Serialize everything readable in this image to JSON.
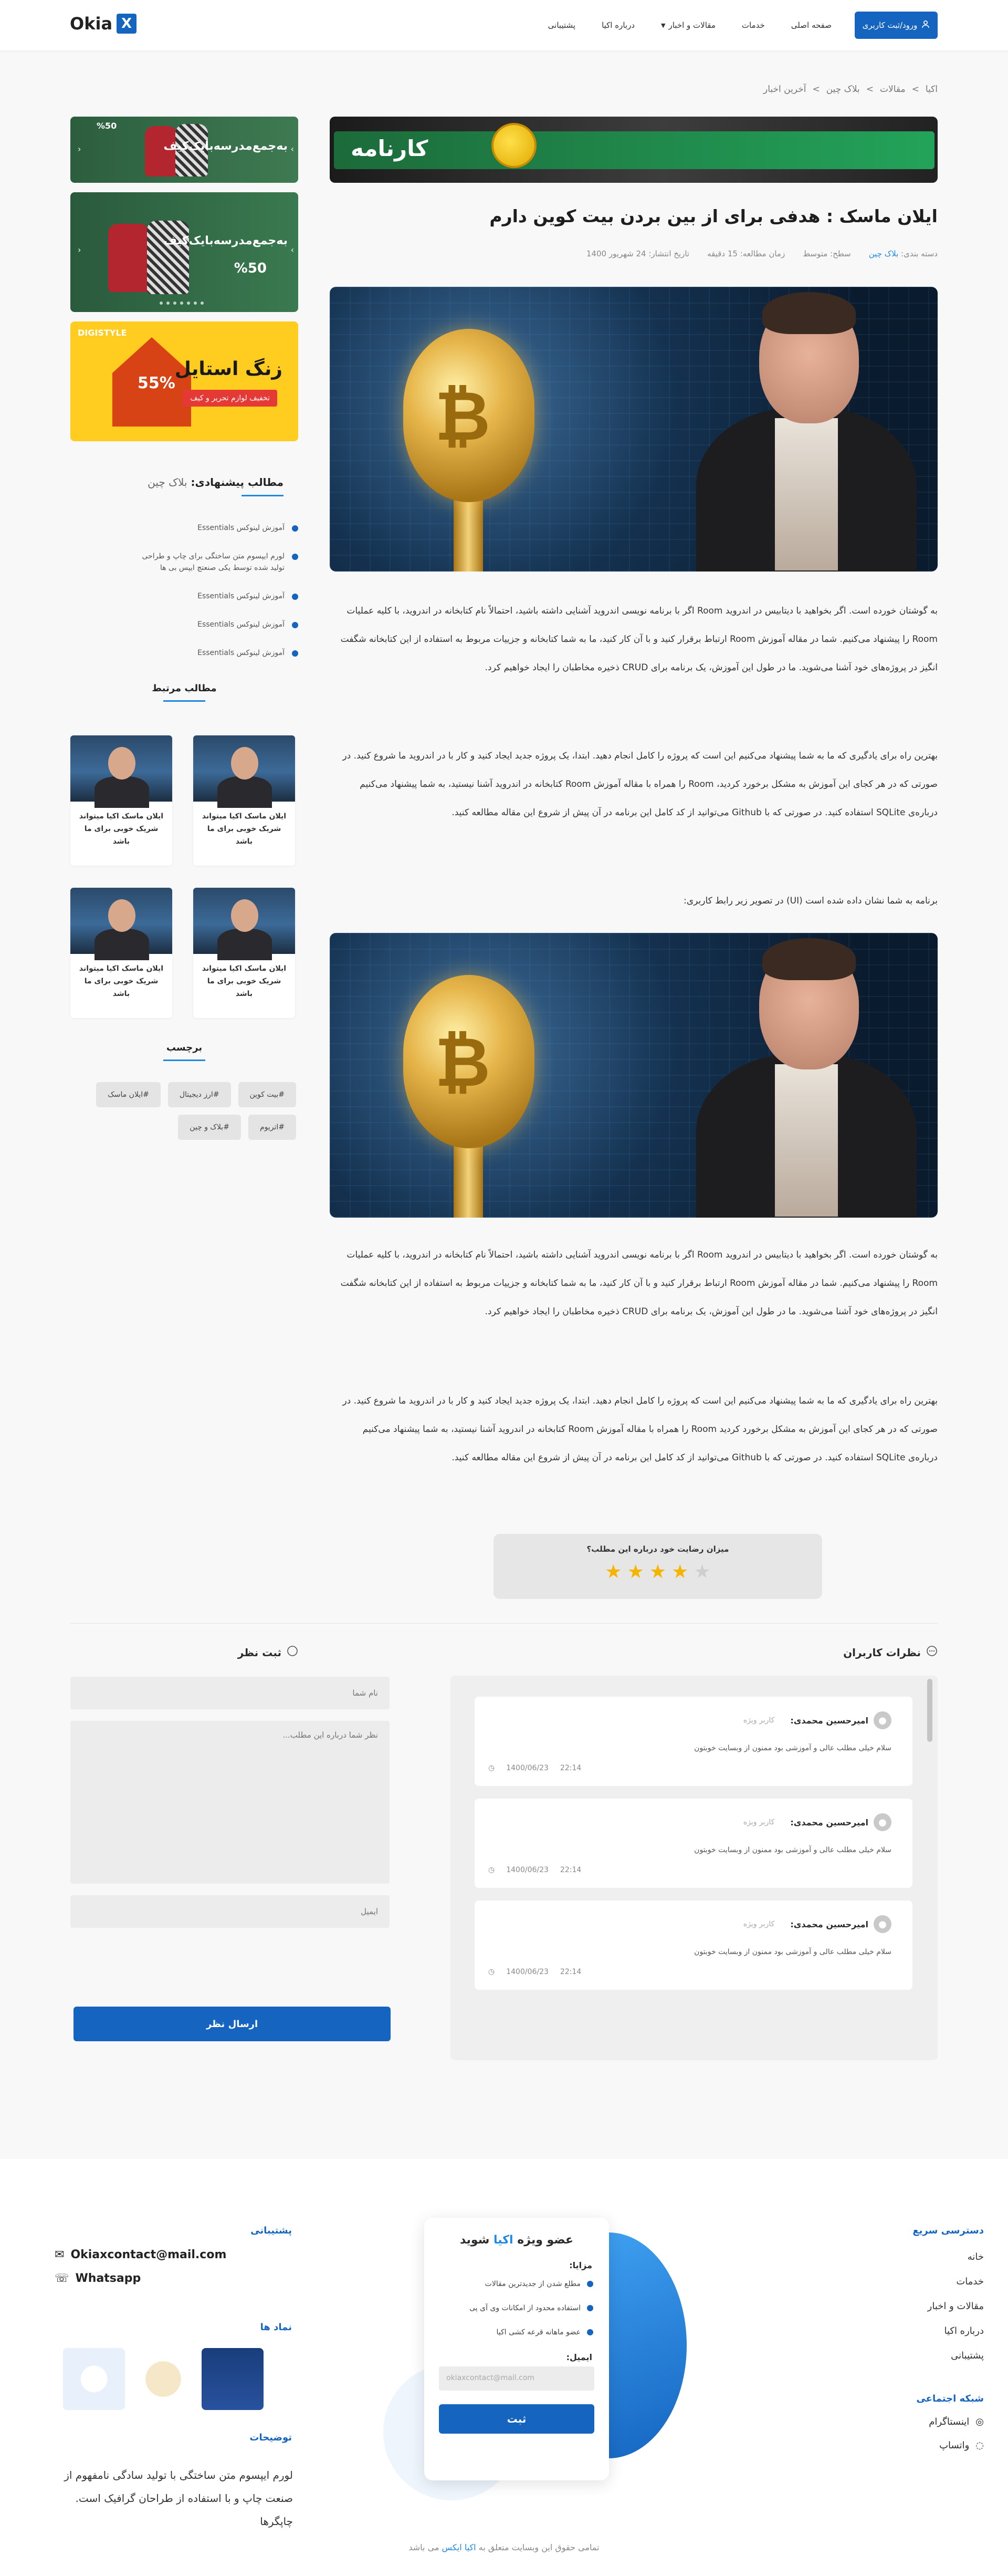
{
  "header": {
    "logo_text": "Okia",
    "logo_mark": "X",
    "login_label": "ورود/ثبت کاربری",
    "nav": [
      {
        "label": "صفحه اصلی"
      },
      {
        "label": "خدمات"
      },
      {
        "label": "مقالات و اخبار"
      },
      {
        "label": "درباره اکیا"
      },
      {
        "label": "پشتیبانی"
      }
    ]
  },
  "breadcrumb": [
    "اکیا",
    ">",
    "مقالات",
    ">",
    "بلاک چین",
    ">",
    "آخرین اخبار"
  ],
  "banner_top_text": "کارنامه",
  "article": {
    "title": "ایلان ماسک : هدفی برای از بین بردن بیت کوین دارم",
    "category_label": "دسته بندی:",
    "category_value": "بلاک چین",
    "level": "سطح: متوسط",
    "read_time": "زمان مطالعه: 15 دقیقه",
    "publish_date": "تاریخ انتشار: 24 شهریور 1400",
    "p1": "به گوشتان خورده است. اگر بخواهید با دیتابیس در اندروید Room اگر با برنامه نویسی اندروید آشنایی داشته باشید، احتمالاً نام کتابخانه در اندروید، با کلیه عملیات Room را پیشنهاد می‌کنیم. شما در مقاله آموزش Room ارتباط برقرار کنید و با آن کار کنید، ما به شما کتابخانه و جزییات مربوط به استفاده از این کتابخانه شگفت انگیز در پروژه‌های خود آشنا می‌شوید. ما در طول این آموزش، یک برنامه برای CRUD ذخیره مخاطبان را ایجاد خواهیم کرد.",
    "p2": "بهترین راه برای یادگیری که ما به شما پیشنهاد می‌کنیم این است که پروژه را کامل انجام دهید. ابتدا، یک پروژه جدید ایجاد کنید و کار با در اندروید ما شروع کنید. در صورتی که در هر کجای این آموزش به مشکل برخورد کردید، Room را همراه با مقاله آموزش Room کتابخانه در اندروید آشنا نیستید، به شما پیشنهاد می‌کنیم درباره‌ی SQLite استفاده کنید. در صورتی که با Github می‌توانید از کد کامل این برنامه در آن پیش از شروع این مقاله مطالعه کنید.",
    "p3": "برنامه به شما نشان داده شده است (UI) در تصویر زیر رابط کاربری:",
    "p4": "به گوشتان خورده است. اگر بخواهید با دیتابیس در اندروید Room اگر با برنامه نویسی اندروید آشنایی داشته باشید، احتمالاً نام کتابخانه در اندروید، با کلیه عملیات Room را پیشنهاد می‌کنیم. شما در مقاله آموزش Room ارتباط برقرار کنید و با آن کار کنید، ما به شما کتابخانه و جزییات مربوط به استفاده از این کتابخانه شگفت انگیز در پروژه‌های خود آشنا می‌شوید. ما در طول این آموزش، یک برنامه برای CRUD ذخیره مخاطبان را ایجاد خواهیم کرد.",
    "p5": "بهترین راه برای یادگیری که ما به شما پیشنهاد می‌کنیم این است که پروژه را کامل انجام دهید. ابتدا، یک پروژه جدید ایجاد کنید و کار با در اندروید ما شروع کنید. در صورتی که در هر کجای این آموزش به مشکل برخورد کردید Room را همراه با مقاله آموزش Room کتابخانه در اندروید آشنا نیستید، به شما پیشنهاد می‌کنیم درباره‌ی SQLite استفاده کنید. در صورتی که با Github می‌توانید از کد کامل این برنامه در آن پیش از شروع این مقاله مطالعه کنید."
  },
  "rating": {
    "question": "میزان رضایت خود درباره این مطلب؟",
    "value": 4,
    "max": 5,
    "star_on_color": "#f5b400",
    "star_off_color": "#cfcfcf"
  },
  "sidebar": {
    "banner1_text": "به‌جمع‌مدرسه‌بایک‌کیف",
    "banner1_pct": "%50",
    "banner2_text": "به‌جمع‌مدرسه‌بایک‌کیف",
    "banner2_pct": "%50",
    "banner3_title": "زنگ استایل",
    "banner3_pct": "55%",
    "banner3_cta": "تخفیف لوازم تحریر و کیف",
    "banner3_brand": "DIGISTYLE",
    "suggested_title": "مطالب پیشنهادی:",
    "suggested_topic": "بلاک چین",
    "suggested": [
      "آموزش لینوکس Essentials",
      "لورم ایپسوم متن ساختگی برای چاپ و طراحی تولید شده توسط یکی صنعتچ ایپس بی‌ ها",
      "آموزش لینوکس Essentials",
      "آموزش لینوکس Essentials",
      "آموزش لینوکس Essentials"
    ],
    "related_title": "مطالب مرتبط",
    "related": [
      "ایلان ماسک اکیا میتواند شریک خوبی برای ما باشد",
      "ایلان ماسک اکیا میتواند شریک خوبی برای ما باشد",
      "ایلان ماسک اکیا میتواند شریک خوبی برای ما باشد",
      "ایلان ماسک اکیا میتواند شریک خوبی برای ما باشد"
    ],
    "tags_title": "برچسب",
    "tags": [
      "#بیت کوین",
      "#ارز دیجیتال",
      "#ایلان ماسک",
      "#اتریوم",
      "#بلاک و چین"
    ]
  },
  "comments": {
    "title": "نظرات کاربران",
    "items": [
      {
        "name": "امیرحسین محمدی:",
        "role": "کاربر ویژه",
        "text": "سلام خیلی مطلب عالی و آموزشی بود ممنون از وبسایت خوبتون",
        "time": "22:14",
        "date": "1400/06/23"
      },
      {
        "name": "امیرحسین محمدی:",
        "role": "کاربر ویژه",
        "text": "سلام خیلی مطلب عالی و آموزشی بود ممنون از وبسایت خوبتون",
        "time": "22:14",
        "date": "1400/06/23"
      },
      {
        "name": "امیرحسین محمدی:",
        "role": "کاربر ویژه",
        "text": "سلام خیلی مطلب عالی و آموزشی بود ممنون از وبسایت خوبتون",
        "time": "22:14",
        "date": "1400/06/23"
      }
    ]
  },
  "form": {
    "title": "ثبت نظر",
    "name_placeholder": "نام شما",
    "text_placeholder": "نظر شما درباره این مطلب...",
    "email_placeholder": "ایمیل",
    "submit_label": "ارسال نظر"
  },
  "footer": {
    "quick_title": "دسترسی سریع",
    "quick_links": [
      "خانه",
      "خدمات",
      "مقالات و اخبار",
      "درباره اکیا",
      "پشتیبانی"
    ],
    "social_title": "شبکه اجتماعی",
    "social": [
      "اینستاگرام",
      "واتساپ"
    ],
    "newsletter": {
      "title_a": "عضو ویژه",
      "title_b": "اکیا",
      "title_c": "شوید",
      "benefits_label": "مزایا:",
      "benefits": [
        "مطلع شدن از جدیدترین مقالات",
        "استفاده محدود از امکانات وی آی پی",
        "عضو ماهانه قرعه کشی اکیا"
      ],
      "email_label": "ایمیل:",
      "email_placeholder": "okiaxcontact@mail.com",
      "submit_label": "ثبت"
    },
    "support_title": "پشتیبانی",
    "support_email": "Okiaxcontact@mail.com",
    "support_whatsapp": "Whatsapp",
    "symbols_title": "نماد ها",
    "desc_title": "توضیحات",
    "desc_text": "لورم ایپسوم متن ساختگی با تولید سادگی نامفهوم از صنعت چاپ و با استفاده از طراحان گرافیک است. چاپگرها",
    "copyright_a": "تمامی حقوق این وبسایت متعلق به",
    "copyright_b": "اکیا ایکس",
    "copyright_c": "می باشد"
  }
}
